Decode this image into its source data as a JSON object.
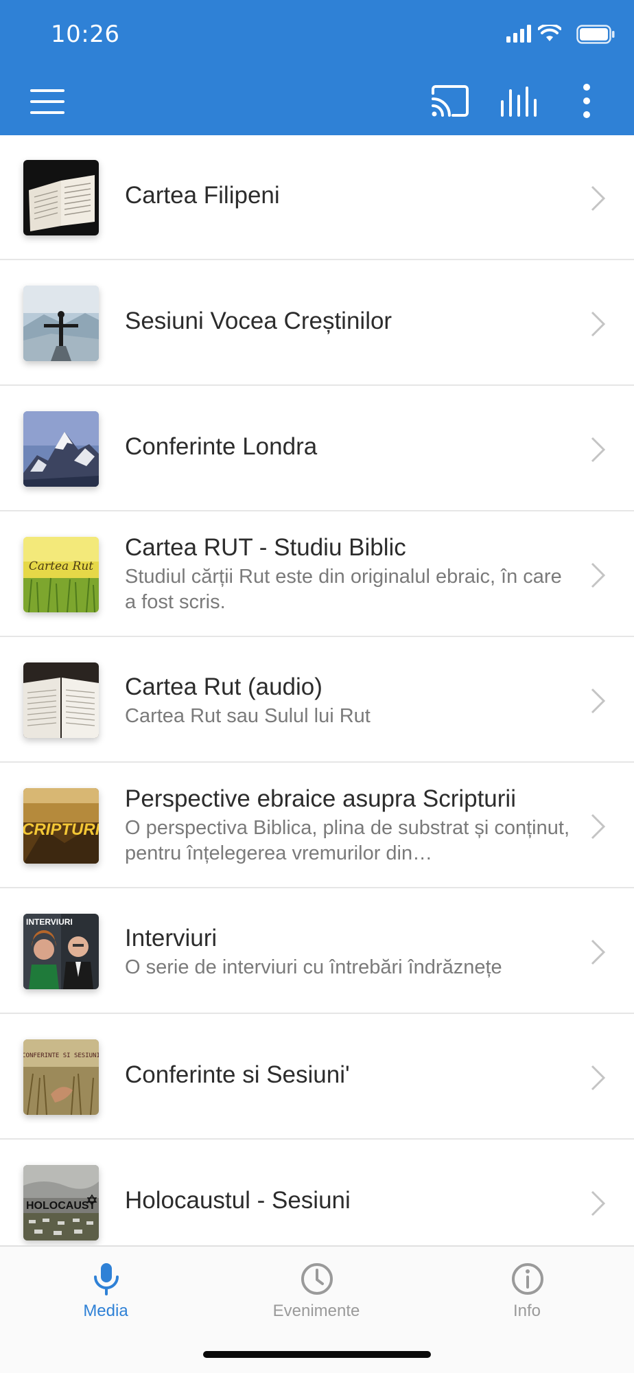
{
  "status_bar": {
    "time": "10:26"
  },
  "header": {
    "accent": "#2f81d6"
  },
  "items": [
    {
      "title": "Cartea Filipeni",
      "subtitle": "",
      "thumb": "open-bible-image"
    },
    {
      "title": "Sesiuni Vocea Creștinilor",
      "subtitle": "",
      "thumb": "man-on-mountain-image"
    },
    {
      "title": "Conferinte Londra",
      "subtitle": "",
      "thumb": "snowy-mountains-image"
    },
    {
      "title": "Cartea RUT - Studiu Biblic",
      "subtitle": "Studiul cărții Rut este din originalul ebraic, în care a fost scris.",
      "thumb": "wheat-field-cartea-rut-image",
      "thumb_text": "Cartea Rut"
    },
    {
      "title": "Cartea Rut (audio)",
      "subtitle": "Cartea Rut sau Sulul lui Rut",
      "thumb": "open-book-image"
    },
    {
      "title": "Perspective ebraice asupra Scripturii",
      "subtitle": "O perspectiva Biblica, plina de substrat și conținut, pentru înțelegerea vremurilor din…",
      "thumb": "scripturii-image",
      "thumb_text": "SCRIPTURII"
    },
    {
      "title": "Interviuri",
      "subtitle": "O serie de interviuri cu întrebări îndrăznețe",
      "thumb": "interviuri-portraits-image",
      "thumb_text": "INTERVIURI"
    },
    {
      "title": "Conferinte si Sesiuni'",
      "subtitle": "",
      "thumb": "wheat-hand-image",
      "thumb_text": "CONFERINTE SI SESIUNI"
    },
    {
      "title": "Holocaustul - Sesiuni",
      "subtitle": "",
      "thumb": "holocaust-memorial-image",
      "thumb_text": "HOLOCAUST"
    }
  ],
  "tabs": [
    {
      "label": "Media",
      "icon": "microphone-icon",
      "active": true,
      "color": "#2f81d6"
    },
    {
      "label": "Evenimente",
      "icon": "clock-icon",
      "active": false,
      "color": "#9a9a9a"
    },
    {
      "label": "Info",
      "icon": "info-icon",
      "active": false,
      "color": "#9a9a9a"
    }
  ]
}
